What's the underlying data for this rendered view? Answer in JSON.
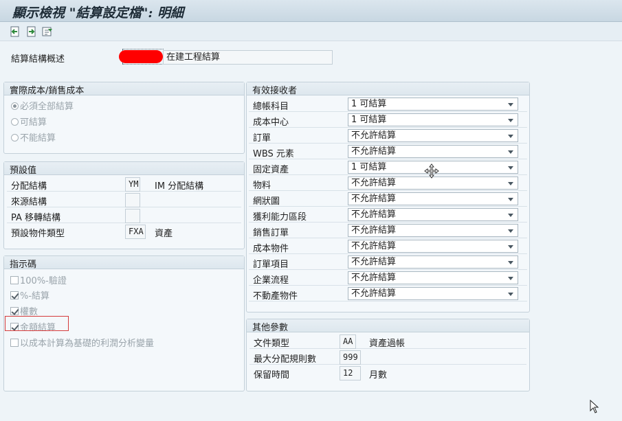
{
  "window_title": "顯示檢視 \"結算設定檔\": 明細",
  "toolbar": {
    "icons": [
      "previous-entry-icon",
      "next-entry-icon",
      "other-entry-icon"
    ]
  },
  "header": {
    "label": "結算結構概述",
    "value": "在建工程結算"
  },
  "cost_group": {
    "title": "實際成本/銷售成本",
    "options": [
      {
        "label": "必須全部結算",
        "selected": true
      },
      {
        "label": "可結算",
        "selected": false
      },
      {
        "label": "不能結算",
        "selected": false
      }
    ]
  },
  "defaults": {
    "title": "預設值",
    "rows": [
      {
        "label": "分配結構",
        "value": "YM",
        "text": "IM 分配結構"
      },
      {
        "label": "來源結構",
        "value": "",
        "text": ""
      },
      {
        "label": "PA 移轉結構",
        "value": "",
        "text": ""
      },
      {
        "label": "預設物件類型",
        "value": "FXA",
        "text": "資產"
      }
    ]
  },
  "indicators": {
    "title": "指示碼",
    "items": [
      {
        "label": "100%-驗證",
        "checked": false
      },
      {
        "label": "%-結算",
        "checked": true
      },
      {
        "label": "權數",
        "checked": true
      },
      {
        "label": "金額結算",
        "checked": true
      },
      {
        "label": "以成本計算為基礎的利潤分析變量",
        "checked": false
      }
    ]
  },
  "receivers": {
    "title": "有效接收者",
    "rows": [
      {
        "label": "總帳科目",
        "value": "1 可結算"
      },
      {
        "label": "成本中心",
        "value": "1 可結算"
      },
      {
        "label": "訂單",
        "value": "不允許結算"
      },
      {
        "label": "WBS 元素",
        "value": "不允許結算"
      },
      {
        "label": "固定資產",
        "value": "1 可結算"
      },
      {
        "label": "物料",
        "value": "不允許結算"
      },
      {
        "label": "網狀圖",
        "value": "不允許結算"
      },
      {
        "label": "獲利能力區段",
        "value": "不允許結算"
      },
      {
        "label": "銷售訂單",
        "value": "不允許結算"
      },
      {
        "label": "成本物件",
        "value": "不允許結算"
      },
      {
        "label": "訂單項目",
        "value": "不允許結算"
      },
      {
        "label": "企業流程",
        "value": "不允許結算"
      },
      {
        "label": "不動產物件",
        "value": "不允許結算"
      }
    ]
  },
  "other": {
    "title": "其他參數",
    "rows": [
      {
        "label": "文件類型",
        "value": "AA",
        "text": "資產過帳"
      },
      {
        "label": "最大分配規則數",
        "value": "999",
        "text": ""
      },
      {
        "label": "保留時間",
        "value": "12",
        "text": "月數"
      }
    ]
  }
}
